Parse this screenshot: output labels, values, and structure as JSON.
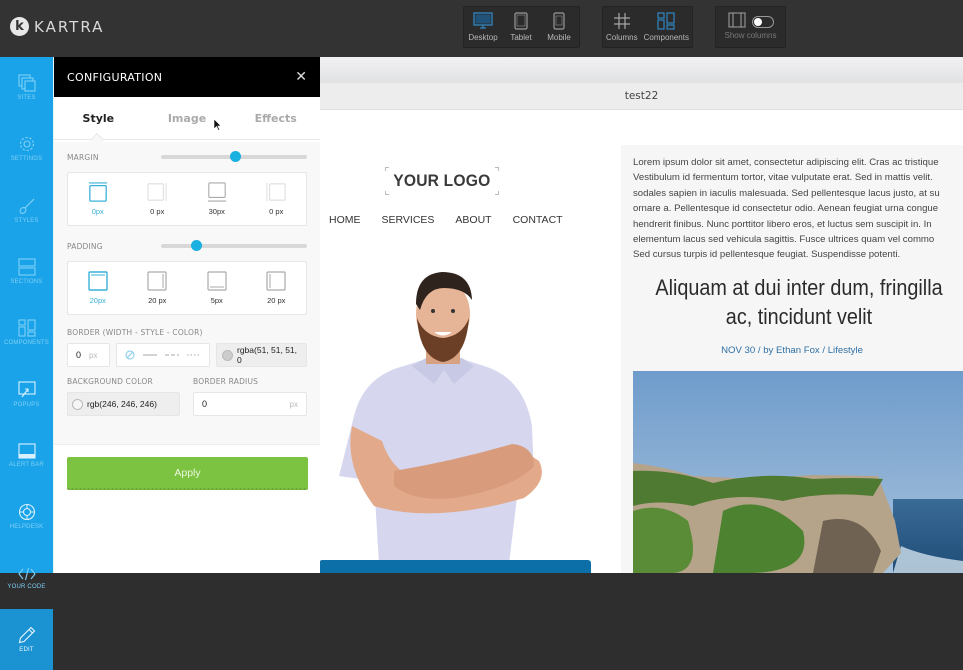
{
  "brand": {
    "mark": "k",
    "name": "KARTRA"
  },
  "toolbar": {
    "device_tools": [
      {
        "label": "Desktop",
        "icon": "desktop-icon",
        "active": true
      },
      {
        "label": "Tablet",
        "icon": "tablet-icon",
        "active": false
      },
      {
        "label": "Mobile",
        "icon": "mobile-icon",
        "active": false
      }
    ],
    "layout_tools": [
      {
        "label": "Columns",
        "icon": "columns-grid-icon",
        "active": false
      },
      {
        "label": "Components",
        "icon": "components-icon",
        "active": true
      }
    ],
    "show_columns": {
      "label": "Show columns",
      "enabled": false
    }
  },
  "sidebar": {
    "items": [
      {
        "label": "SITES",
        "icon": "sites-icon"
      },
      {
        "label": "SETTINGS",
        "icon": "gear-icon"
      },
      {
        "label": "STYLES",
        "icon": "brush-icon"
      },
      {
        "label": "SECTIONS",
        "icon": "sections-icon"
      },
      {
        "label": "COMPONENTS",
        "icon": "components-icon"
      },
      {
        "label": "POPUPS",
        "icon": "popup-icon"
      },
      {
        "label": "ALERT BAR",
        "icon": "alert-bar-icon"
      },
      {
        "label": "HELPDESK",
        "icon": "lifebuoy-icon"
      },
      {
        "label": "YOUR CODE",
        "icon": "code-icon"
      },
      {
        "label": "EDIT",
        "icon": "pencil-icon",
        "active": true
      }
    ]
  },
  "config": {
    "title": "CONFIGURATION",
    "close_icon": "✕",
    "tabs": [
      {
        "label": "Style",
        "active": true
      },
      {
        "label": "Image",
        "active": false
      },
      {
        "label": "Effects",
        "active": false
      }
    ],
    "margin": {
      "label": "MARGIN",
      "slider_percent": 51,
      "sides": [
        {
          "side": "top",
          "value": "0px",
          "active": true
        },
        {
          "side": "right",
          "value": "0 px",
          "active": false
        },
        {
          "side": "bottom",
          "value": "30px",
          "active": false
        },
        {
          "side": "left",
          "value": "0 px",
          "active": false
        }
      ]
    },
    "padding": {
      "label": "PADDING",
      "slider_percent": 24,
      "sides": [
        {
          "side": "top",
          "value": "20px",
          "active": true
        },
        {
          "side": "right",
          "value": "20 px",
          "active": false
        },
        {
          "side": "bottom",
          "value": "5px",
          "active": false
        },
        {
          "side": "left",
          "value": "20 px",
          "active": false
        }
      ]
    },
    "border": {
      "label": "BORDER (WIDTH - STYLE - COLOR)",
      "width_value": "0",
      "width_unit": "px",
      "styles": [
        "none",
        "solid",
        "dashed",
        "dotted"
      ],
      "color_value": "rgba(51, 51, 51, 0"
    },
    "background_color": {
      "label": "BACKGROUND COLOR",
      "value": "rgb(246, 246, 246)"
    },
    "border_radius": {
      "label": "BORDER RADIUS",
      "value": "0",
      "unit": "px"
    },
    "apply_label": "Apply"
  },
  "canvas": {
    "page_title": "test22",
    "logo_text": "YOUR LOGO",
    "nav": [
      "HOME",
      "SERVICES",
      "ABOUT",
      "CONTACT"
    ],
    "lorem": "Lorem ipsum dolor sit amet, consectetur adipiscing elit. Cras ac tristique\nVestibulum id fermentum tortor, vitae vulputate erat. Sed in mattis velit.\nsodales sapien in iaculis malesuada. Sed pellentesque lacus justo, at su\nornare a. Pellentesque id consectetur odio. Aenean feugiat urna congue\nhendrerit finibus. Nunc porttitor libero eros, et luctus sem suscipit in. In\nelementum lacus sed vehicula sagittis. Fusce ultrices quam vel commo\nSed cursus turpis id pellentesque feugiat. Suspendisse potenti.",
    "post_title": "Aliquam at dui inter dum, fringilla ac, tincidunt velit",
    "post_meta": "NOV 30 / by Ethan Fox / Lifestyle"
  },
  "colors": {
    "topbar": "#333333",
    "sidebar": "#1aa3e8",
    "accent_blue": "#1ab0e0",
    "apply_green": "#7dc342",
    "meta_link": "#2f6fa3"
  }
}
